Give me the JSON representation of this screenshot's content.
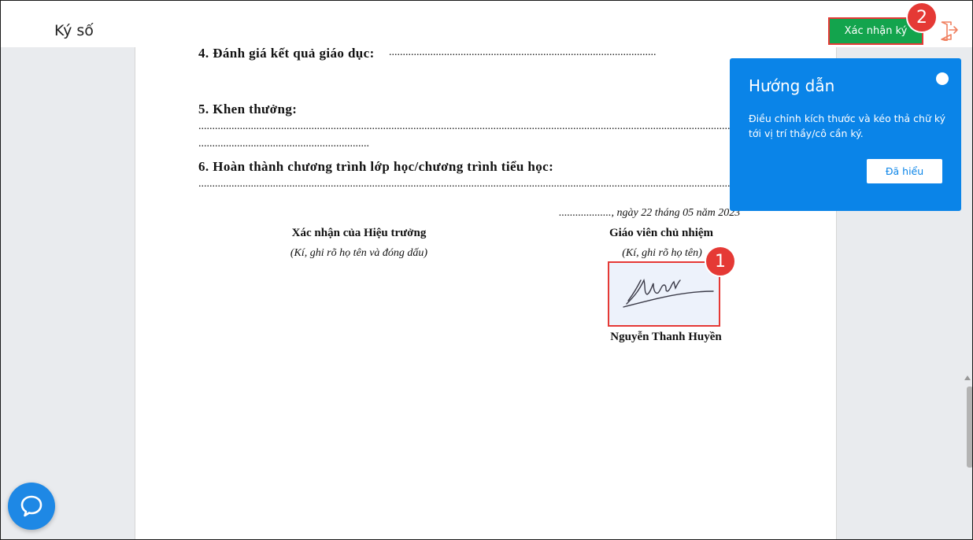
{
  "app": {
    "title": "Ký số"
  },
  "toolbar": {
    "confirm_label": "Xác nhận ký",
    "confirm_color": "#13a44d",
    "exit_icon": "exit-door-icon"
  },
  "badges": {
    "step1": "1",
    "step2": "2"
  },
  "document": {
    "section4": {
      "heading": "4. Đánh giá kết quả giáo dục:",
      "dots": "........................................................................................................................"
    },
    "section5": {
      "heading": "5. Khen thưởng:",
      "dots_line1": "......................................................................................................................................................................................................................................................",
      "dots_line2": "..................................................................."
    },
    "section6": {
      "heading": "6. Hoàn thành chương trình lớp học/chương trình tiểu học:",
      "dots": "......................................................................................................................................................................................................................................................"
    },
    "date_line": "..................., ngày 22 tháng 05 năm 2023",
    "principal": {
      "title": "Xác nhận của Hiệu trưởng",
      "note": "(Kí, ghi rõ họ tên và đóng dấu)"
    },
    "teacher": {
      "title": "Giáo viên chủ nhiệm",
      "note": "(Kí, ghi rõ họ tên)",
      "name": "Nguyễn Thanh Huyền",
      "signature_icon": "handwritten-signature"
    }
  },
  "guide": {
    "title": "Hướng dẫn",
    "text": "Điều chỉnh kích thước và kéo thả chữ ký tới vị trí thầy/cô cần ký.",
    "button_label": "Đã hiểu",
    "bg_color": "#0a84e8"
  },
  "chat": {
    "icon": "chat-bubble-icon"
  }
}
